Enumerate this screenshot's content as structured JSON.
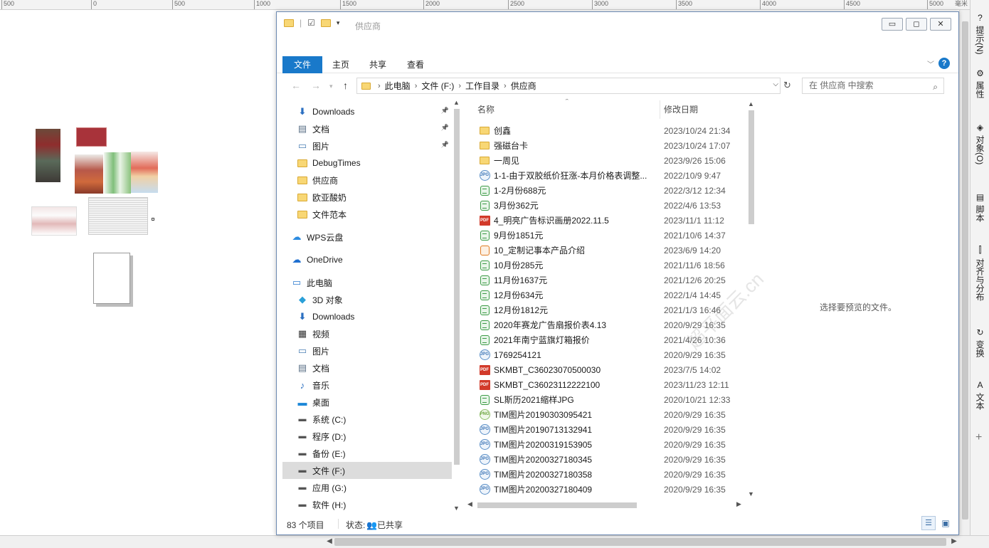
{
  "ruler": {
    "ticks": [
      "500",
      "0",
      "500",
      "1000",
      "1500",
      "2000",
      "2500",
      "3000",
      "3500",
      "4000",
      "4500",
      "5000",
      "毫米"
    ]
  },
  "docker": {
    "tabs": [
      {
        "label": "提示(N)",
        "icon": "question-icon"
      },
      {
        "label": "属性",
        "icon": "properties-icon"
      },
      {
        "label": "对象(O)",
        "icon": "objects-icon"
      },
      {
        "label": "脚本",
        "icon": "script-icon"
      },
      {
        "label": "对齐与分布",
        "icon": "align-icon"
      },
      {
        "label": "变换",
        "icon": "transform-icon"
      },
      {
        "label": "文本",
        "icon": "text-icon"
      }
    ],
    "add_label": "+"
  },
  "window": {
    "title": "供应商",
    "ribbon_tabs": [
      "文件",
      "主页",
      "共享",
      "查看"
    ],
    "help_label": "?",
    "address": {
      "crumbs": [
        "此电脑",
        "文件 (F:)",
        "工作目录",
        "供应商"
      ]
    },
    "search": {
      "placeholder": "在 供应商 中搜索"
    },
    "nav": [
      {
        "label": "Downloads",
        "icon": "download-icon",
        "pinned": true
      },
      {
        "label": "文档",
        "icon": "document-icon",
        "pinned": true
      },
      {
        "label": "图片",
        "icon": "pictures-icon",
        "pinned": true
      },
      {
        "label": "DebugTimes",
        "icon": "folder-icon",
        "pinned": false
      },
      {
        "label": "供应商",
        "icon": "folder-icon",
        "pinned": false
      },
      {
        "label": "欧亚酸奶",
        "icon": "folder-icon",
        "pinned": false
      },
      {
        "label": "文件范本",
        "icon": "folder-icon",
        "pinned": false
      },
      {
        "label": "WPS云盘",
        "icon": "cloud-icon",
        "pinned": false
      },
      {
        "label": "OneDrive",
        "icon": "onedrive-icon",
        "pinned": false
      },
      {
        "label": "此电脑",
        "icon": "computer-icon",
        "pinned": false
      },
      {
        "label": "3D 对象",
        "icon": "cube-icon",
        "pinned": false
      },
      {
        "label": "Downloads",
        "icon": "download-icon",
        "pinned": false
      },
      {
        "label": "视频",
        "icon": "video-icon",
        "pinned": false
      },
      {
        "label": "图片",
        "icon": "pictures-icon",
        "pinned": false
      },
      {
        "label": "文档",
        "icon": "document-icon",
        "pinned": false
      },
      {
        "label": "音乐",
        "icon": "music-icon",
        "pinned": false
      },
      {
        "label": "桌面",
        "icon": "desktop-icon",
        "pinned": false
      },
      {
        "label": "系统 (C:)",
        "icon": "drive-icon",
        "pinned": false
      },
      {
        "label": "程序 (D:)",
        "icon": "drive-icon",
        "pinned": false
      },
      {
        "label": "备份 (E:)",
        "icon": "drive-icon",
        "pinned": false
      },
      {
        "label": "文件 (F:)",
        "icon": "drive-icon",
        "pinned": false,
        "selected": true
      },
      {
        "label": "应用 (G:)",
        "icon": "drive-icon",
        "pinned": false
      },
      {
        "label": "软件 (H:)",
        "icon": "drive-icon",
        "pinned": false
      }
    ],
    "columns": {
      "name": "名称",
      "date": "修改日期"
    },
    "files": [
      {
        "name": "创鑫",
        "date": "2023/10/24 21:34",
        "type": "folder"
      },
      {
        "name": "强磁台卡",
        "date": "2023/10/24 17:07",
        "type": "folder"
      },
      {
        "name": "一周见",
        "date": "2023/9/26 15:06",
        "type": "folder"
      },
      {
        "name": "1-1-由于双胶纸价狂涨-本月价格表调整...",
        "date": "2022/10/9 9:47",
        "type": "jpg"
      },
      {
        "name": "1-2月份688元",
        "date": "2022/3/12 12:34",
        "type": "xls"
      },
      {
        "name": "3月份362元",
        "date": "2022/4/6 13:53",
        "type": "xls"
      },
      {
        "name": "4_明亮广告标识画册2022.11.5",
        "date": "2023/11/1 11:12",
        "type": "pdf"
      },
      {
        "name": "9月份1851元",
        "date": "2021/10/6 14:37",
        "type": "xls"
      },
      {
        "name": "10_定制记事本产品介绍",
        "date": "2023/6/9 14:20",
        "type": "ppt"
      },
      {
        "name": "10月份285元",
        "date": "2021/11/6 18:56",
        "type": "xls"
      },
      {
        "name": "11月份1637元",
        "date": "2021/12/6 20:25",
        "type": "xls"
      },
      {
        "name": "12月份634元",
        "date": "2022/1/4 14:45",
        "type": "xls"
      },
      {
        "name": "12月份1812元",
        "date": "2021/1/3 16:46",
        "type": "xls"
      },
      {
        "name": "2020年赛龙广告扇报价表4.13",
        "date": "2020/9/29 16:35",
        "type": "xls"
      },
      {
        "name": "2021年南宁蓝旗灯箱报价",
        "date": "2021/4/26 10:36",
        "type": "xls"
      },
      {
        "name": "1769254121",
        "date": "2020/9/29 16:35",
        "type": "jpg"
      },
      {
        "name": "SKMBT_C36023070500030",
        "date": "2023/7/5 14:02",
        "type": "pdf"
      },
      {
        "name": "SKMBT_C36023112222100",
        "date": "2023/11/23 12:11",
        "type": "pdf"
      },
      {
        "name": "SL斯历2021缩样JPG",
        "date": "2020/10/21 12:33",
        "type": "xls"
      },
      {
        "name": "TIM图片20190303095421",
        "date": "2020/9/29 16:35",
        "type": "png"
      },
      {
        "name": "TIM图片20190713132941",
        "date": "2020/9/29 16:35",
        "type": "jpg"
      },
      {
        "name": "TIM图片20200319153905",
        "date": "2020/9/29 16:35",
        "type": "jpg"
      },
      {
        "name": "TIM图片20200327180345",
        "date": "2020/9/29 16:35",
        "type": "jpg"
      },
      {
        "name": "TIM图片20200327180358",
        "date": "2020/9/29 16:35",
        "type": "jpg"
      },
      {
        "name": "TIM图片20200327180409",
        "date": "2020/9/29 16:35",
        "type": "jpg"
      }
    ],
    "preview_text": "选择要预览的文件。",
    "status": {
      "count": "83 个项目",
      "state_label": "状态:",
      "shared_label": "已共享"
    }
  },
  "watermark": "超平面云.cn"
}
